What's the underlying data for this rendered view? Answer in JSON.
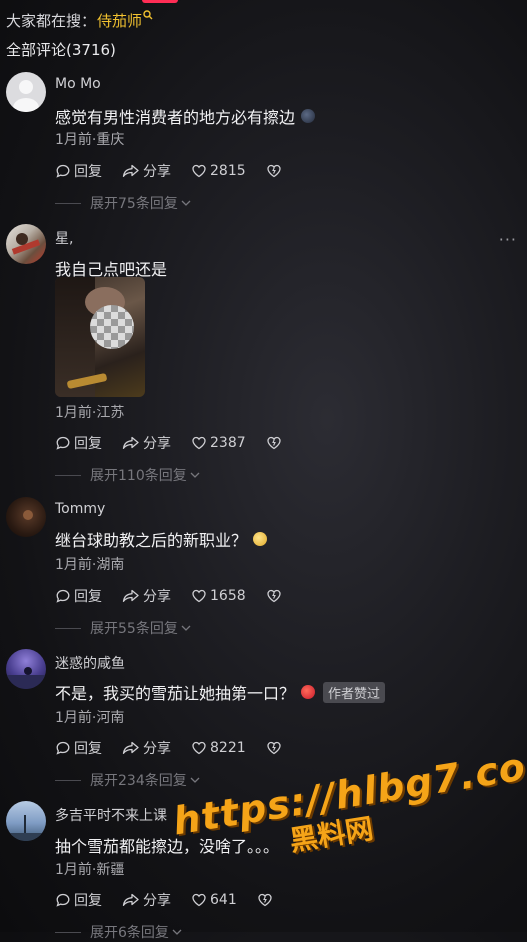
{
  "header": {
    "search_prefix": "大家都在搜：",
    "search_keyword": "侍茄师",
    "total_comments": "全部评论(3716)"
  },
  "actions": {
    "reply": "回复",
    "share": "分享"
  },
  "comments": [
    {
      "author": "Mo Mo",
      "text": "感觉有男性消费者的地方必有擦边",
      "meta": "1月前·重庆",
      "likes": "2815",
      "expand": "展开75条回复"
    },
    {
      "author": "星,",
      "text": "我自己点吧还是",
      "meta": "1月前·江苏",
      "likes": "2387",
      "expand": "展开110条回复"
    },
    {
      "author": "Tommy",
      "text": "继台球助教之后的新职业？",
      "meta": "1月前·湖南",
      "likes": "1658",
      "expand": "展开55条回复"
    },
    {
      "author": "迷惑的咸鱼",
      "text": "不是，我买的雪茄让她抽第一口？",
      "badge": "作者赞过",
      "meta": "1月前·河南",
      "likes": "8221",
      "expand": "展开234条回复"
    },
    {
      "author": "多吉平时不来上课",
      "text": "抽个雪茄都能擦边，没啥了。。。",
      "meta": "1月前·新疆",
      "likes": "641",
      "expand": "展开6条回复"
    }
  ],
  "watermark": {
    "url": "https://hlbg7.com",
    "name": "黑料网"
  },
  "colors": {
    "keyword": "#f2c230",
    "accent": "#ff2d55",
    "watermark": "#f5a418"
  }
}
